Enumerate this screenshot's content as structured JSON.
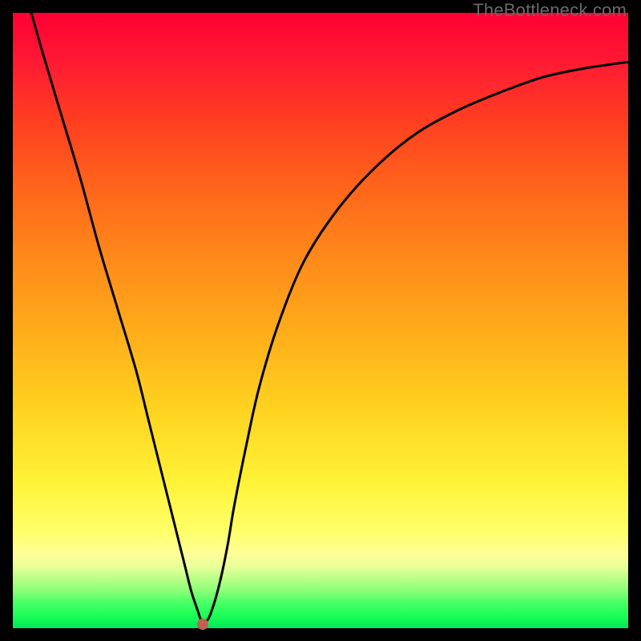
{
  "watermark": {
    "text": "TheBottleneck.com"
  },
  "chart_data": {
    "type": "line",
    "title": "",
    "xlabel": "",
    "ylabel": "",
    "xlim": [
      0,
      100
    ],
    "ylim": [
      0,
      100
    ],
    "x": [
      3,
      5,
      8,
      11,
      14,
      17,
      20,
      22,
      24,
      25.5,
      27,
      28,
      29,
      30,
      30.5,
      31,
      31.5,
      32,
      33,
      34,
      35,
      36,
      38,
      40,
      43,
      47,
      52,
      58,
      65,
      72,
      79,
      86,
      93,
      100
    ],
    "values": [
      100,
      93,
      83,
      73,
      62,
      52,
      42,
      34,
      26,
      20,
      14,
      10,
      6,
      3,
      1.5,
      0.8,
      1.2,
      2,
      5,
      9,
      14,
      20,
      30,
      39,
      49,
      59,
      67,
      74,
      80,
      84,
      87,
      89.5,
      91,
      92
    ],
    "marker": {
      "x": 30.8,
      "y": 0.6
    },
    "left_segment_start": {
      "x": 3,
      "y": 100
    },
    "colors": {
      "curve": "#000000",
      "marker": "#c56052",
      "gradient_top": "#ff0033",
      "gradient_mid": "#ffd11f",
      "gradient_bottom": "#00e85b",
      "frame": "#000000"
    },
    "grid": false,
    "legend": false
  }
}
